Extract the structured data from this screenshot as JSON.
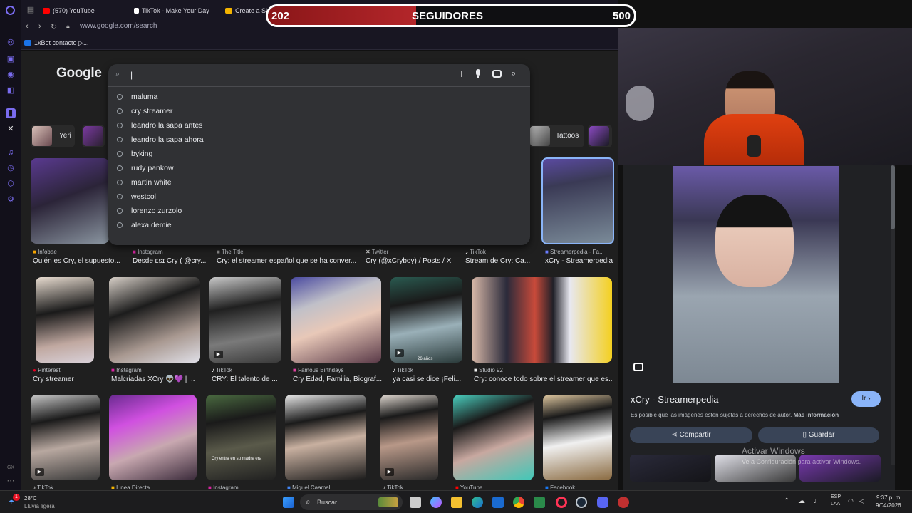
{
  "browser": {
    "tabs": [
      {
        "label": "(570) YouTube",
        "color": "#ff0000"
      },
      {
        "label": "TikTok - Make Your Day",
        "color": "#ffffff"
      },
      {
        "label": "Create a Si",
        "color": "#f4b400"
      }
    ],
    "url": "www.google.com/search",
    "bookmark": "1xBet contacto ▷..."
  },
  "counter": {
    "current": "202",
    "label": "SEGUIDORES",
    "goal": "500",
    "progress": 0.404
  },
  "google": {
    "logo": "Google",
    "search_value": "|",
    "suggestions": [
      "maluma",
      "cry streamer",
      "leandro la sapa antes",
      "leandro la sapa ahora",
      "byking",
      "rudy pankow",
      "martin white",
      "westcol",
      "lorenzo zurzolo",
      "alexa demie"
    ]
  },
  "chips": [
    {
      "label": "Yeri"
    },
    {
      "label": "Tattoos"
    }
  ],
  "row1": [
    {
      "source": "Infobae",
      "caption": "Quién es Cry, el supuesto...",
      "src_color": "#f4a400"
    },
    {
      "source": "Instagram",
      "caption": "Desde ᴇsɪ Cry ( @cry...",
      "src_color": "#d6249f"
    },
    {
      "source": "The Title",
      "caption": "Cry: el streamer español que se ha conver...",
      "src_color": "#888888"
    },
    {
      "source": "Twitter",
      "caption": "Cry (@xCryboy) / Posts / X",
      "src_color": "#ffffff"
    },
    {
      "source": "TikTok",
      "caption": "Stream de Cry: Ca...",
      "src_color": "#ffffff"
    },
    {
      "source": "Streamerpedia - Fa...",
      "caption": "xCry - Streamerpedia",
      "src_color": "#6a7cff"
    }
  ],
  "row2": [
    {
      "source": "Pinterest",
      "caption": "Cry streamer",
      "src_color": "#e60023"
    },
    {
      "source": "Instagram",
      "caption": "Malcriadas XCry 👽💜 | ...",
      "src_color": "#d6249f"
    },
    {
      "source": "TikTok",
      "caption": "CRY: El talento de ...",
      "src_color": "#ffffff"
    },
    {
      "source": "Famous Birthdays",
      "caption": "Cry Edad, Familia, Biograf...",
      "src_color": "#e040a0"
    },
    {
      "source": "TikTok",
      "caption": "ya casi se dice ¡Feli...",
      "src_color": "#ffffff"
    },
    {
      "source": "Studio 92",
      "caption": "Cry: conoce todo sobre el streamer que es...",
      "src_color": "#f0f0f0"
    }
  ],
  "row3": [
    {
      "source": "TikTok",
      "src_color": "#ffffff"
    },
    {
      "source": "Linea Directa",
      "src_color": "#f4b400"
    },
    {
      "source": "Instagram",
      "src_color": "#d6249f"
    },
    {
      "source": "Miguel Caamal",
      "src_color": "#4285f4"
    },
    {
      "source": "TikTok",
      "src_color": "#ffffff"
    },
    {
      "source": "YouTube",
      "src_color": "#ff0000"
    },
    {
      "source": "Facebook",
      "src_color": "#1877f2"
    }
  ],
  "row3_tile_text": "Cry entra en su madre era",
  "tile_badge": "26 años",
  "panel": {
    "title": "xCry - Streamerpedia",
    "go_label": "Ir",
    "notice": "Es posible que las imágenes estén sujetas a derechos de autor.",
    "notice_link": "Más información",
    "share_label": "Compartir",
    "save_label": "Guardar"
  },
  "watermark": {
    "title": "Activar Windows",
    "subtitle": "Ve a Configuración para activar Windows."
  },
  "taskbar": {
    "weather_temp": "28°C",
    "weather_desc": "Lluvia ligera",
    "weather_badge": "1",
    "search_label": "Buscar",
    "lang_top": "ESP",
    "lang_bottom": "LAA",
    "time": "9:37 p. m.",
    "date": "9/04/2026"
  },
  "sidebar_bottom_label": "GX"
}
